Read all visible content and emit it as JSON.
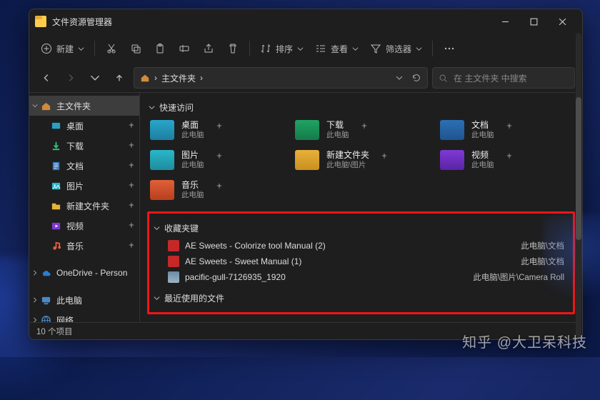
{
  "window": {
    "title": "文件资源管理器"
  },
  "toolbar": {
    "new": "新建",
    "sort": "排序",
    "view": "查看",
    "filter": "筛选器"
  },
  "address": {
    "crumb_sep": "›",
    "root": "主文件夹"
  },
  "search": {
    "placeholder": "在 主文件夹 中搜索"
  },
  "sidebar": {
    "home": "主文件夹",
    "items": [
      {
        "label": "桌面"
      },
      {
        "label": "下载"
      },
      {
        "label": "文档"
      },
      {
        "label": "图片"
      },
      {
        "label": "新建文件夹"
      },
      {
        "label": "视频"
      },
      {
        "label": "音乐"
      }
    ],
    "onedrive": "OneDrive - Person",
    "thispc": "此电脑",
    "network": "网络"
  },
  "sections": {
    "quick": "快速访问",
    "fav": "收藏夹键",
    "recent": "最近使用的文件"
  },
  "quick_access": [
    {
      "name": "桌面",
      "path": "此电脑",
      "thumb": "col-desktop"
    },
    {
      "name": "下载",
      "path": "此电脑",
      "thumb": "col-dl"
    },
    {
      "name": "文档",
      "path": "此电脑",
      "thumb": "col-doc"
    },
    {
      "name": "图片",
      "path": "此电脑",
      "thumb": "col-pic"
    },
    {
      "name": "新建文件夹",
      "path": "此电脑\\图片",
      "thumb": "col-newf"
    },
    {
      "name": "视频",
      "path": "此电脑",
      "thumb": "col-vid"
    },
    {
      "name": "音乐",
      "path": "此电脑",
      "thumb": "col-music"
    }
  ],
  "favorites": [
    {
      "name": "AE Sweets - Colorize tool Manual (2)",
      "loc": "此电脑\\文档",
      "icon": "pdf"
    },
    {
      "name": "AE Sweets - Sweet Manual (1)",
      "loc": "此电脑\\文档",
      "icon": "pdf"
    },
    {
      "name": "pacific-gull-7126935_1920",
      "loc": "此电脑\\图片\\Camera Roll",
      "icon": "img"
    }
  ],
  "status": {
    "count": "10 个项目"
  },
  "watermark": "知乎  @大卫呆科技"
}
